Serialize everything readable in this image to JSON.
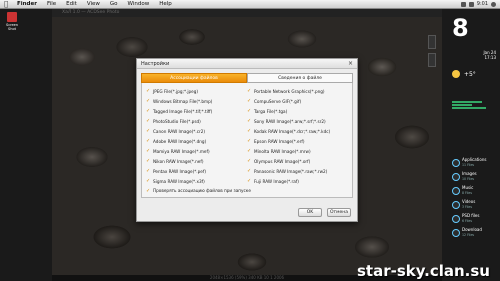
{
  "menubar": {
    "items": [
      "Finder",
      "File",
      "Edit",
      "View",
      "Go",
      "Window",
      "Help"
    ],
    "clock": "9:01"
  },
  "viewer": {
    "title": "ХаЛ 1.0 — ACDSee Photo",
    "status": "2048×1536  (59%)  340 KB  10 1 2006"
  },
  "desktop_icon": {
    "label": "Screen Shot"
  },
  "widgets": {
    "clock_digit": "8",
    "date_line1": "Jan 24",
    "date_line2": "17:13",
    "temperature": "+5°",
    "stacks": [
      {
        "name": "Applications",
        "sub": "11 Files"
      },
      {
        "name": "Images",
        "sub": "10 Files"
      },
      {
        "name": "Music",
        "sub": "8 Files"
      },
      {
        "name": "Videos",
        "sub": "3 Files"
      },
      {
        "name": "PSD files",
        "sub": "6 Files"
      },
      {
        "name": "Download",
        "sub": "12 Files"
      }
    ]
  },
  "dialog": {
    "title": "Настройки",
    "tabs": [
      "Ассоциации файлов",
      "Сведения о файле"
    ],
    "left_formats": [
      "JPEG File(*.jpg;*.jpeg)",
      "Windows Bitmap File(*.bmp)",
      "Tagged Image File(*.tif;*.tiff)",
      "PhotoStudio File(*.psd)",
      "Canon RAW Image(*.cr2)",
      "Adobe RAW Image(*.dng)",
      "Mamiya RAW Image(*.mef)",
      "Nikon RAW Image(*.nef)",
      "Pentax RAW Image(*.pef)",
      "Sigma RAW Image(*.x3f)"
    ],
    "right_formats": [
      "Portable Network Graphics(*.png)",
      "CompuServe GIF(*.gif)",
      "Targa File(*.tga)",
      "Sony RAW Image(*.arw;*.srf;*.sr2)",
      "Kodak RAW Image(*.dcr;*.raw;*.kdc)",
      "Epson RAW Image(*.erf)",
      "Minolta RAW Image(*.mrw)",
      "Olympus RAW Image(*.orf)",
      "Panasonic RAW Image(*.raw;*.rw2)",
      "Fuji RAW Image(*.raf)"
    ],
    "verify_label": "Проверять ассоциацию файлов при запуске",
    "ok_label": "OK",
    "cancel_label": "Отмена"
  },
  "watermark": "star-sky.clan.su"
}
